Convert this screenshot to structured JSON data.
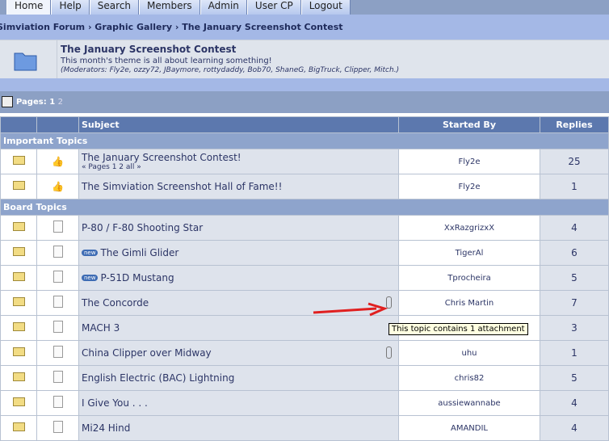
{
  "tabs": [
    "Home",
    "Help",
    "Search",
    "Members",
    "Admin",
    "User CP",
    "Logout"
  ],
  "breadcrumb": "Simviation Forum › Graphic Gallery › The January Screenshot Contest",
  "forum": {
    "title": "The January Screenshot Contest",
    "description": "This month's theme is all about learning something!",
    "moderators": "(Moderators: Fly2e, ozzy72, JBaymore, rottydaddy, Bob70, ShaneG, BigTruck, Clipper, Mitch.)"
  },
  "pages": {
    "label": "Pages:",
    "current": "1",
    "other": "2"
  },
  "columns": {
    "subject": "Subject",
    "started_by": "Started By",
    "replies": "Replies"
  },
  "sections": {
    "important": "Important Topics",
    "board": "Board Topics"
  },
  "important": [
    {
      "subject": "The January Screenshot Contest!",
      "pages": "« Pages 1 2 all »",
      "by": "Fly2e",
      "replies": "25"
    },
    {
      "subject": "The Simviation Screenshot Hall of Fame!!",
      "by": "Fly2e",
      "replies": "1"
    }
  ],
  "topics": [
    {
      "subject": "P-80 / F-80 Shooting Star",
      "by": "XxRazgrizxX",
      "replies": "4"
    },
    {
      "subject": "The Gimli Glider",
      "new": "new",
      "by": "TigerAl",
      "replies": "6"
    },
    {
      "subject": "P-51D Mustang",
      "new": "new",
      "by": "Tprocheira",
      "replies": "5"
    },
    {
      "subject": "The Concorde",
      "by": "Chris Martin",
      "replies": "7",
      "clip": true
    },
    {
      "subject": "MACH 3",
      "by": "",
      "replies": "3"
    },
    {
      "subject": "China Clipper over Midway",
      "by": "uhu",
      "replies": "1",
      "clip": true
    },
    {
      "subject": "English Electric (BAC) Lightning",
      "by": "chris82",
      "replies": "5"
    },
    {
      "subject": "I Give You . . .",
      "by": "aussiewannabe",
      "replies": "4"
    },
    {
      "subject": "Mi24 Hind",
      "by": "AMANDIL",
      "replies": "4"
    }
  ],
  "tooltip": "This topic contains 1 attachment"
}
